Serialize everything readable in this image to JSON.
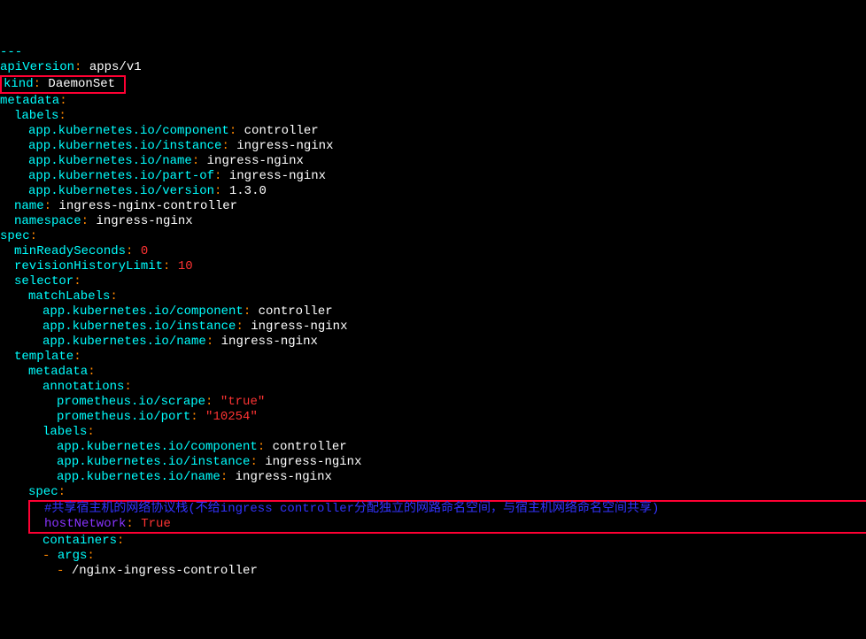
{
  "separator": "---",
  "apiVersion": {
    "key": "apiVersion",
    "value": "apps/v1"
  },
  "kind": {
    "key": "kind",
    "value": "DaemonSet"
  },
  "metadata": {
    "key": "metadata",
    "labelsKey": "labels",
    "labels": {
      "componentKey": "app.kubernetes.io/component",
      "componentVal": "controller",
      "instanceKey": "app.kubernetes.io/instance",
      "instanceVal": "ingress-nginx",
      "nameKey": "app.kubernetes.io/name",
      "nameVal": "ingress-nginx",
      "partofKey": "app.kubernetes.io/part-of",
      "partofVal": "ingress-nginx",
      "versionKey": "app.kubernetes.io/version",
      "versionVal": "1.3.0"
    },
    "nameKey": "name",
    "nameVal": "ingress-nginx-controller",
    "nsKey": "namespace",
    "nsVal": "ingress-nginx"
  },
  "spec": {
    "key": "spec",
    "minReadyKey": "minReadySeconds",
    "minReadyVal": "0",
    "revHistKey": "revisionHistoryLimit",
    "revHistVal": "10",
    "selectorKey": "selector",
    "matchLabelsKey": "matchLabels",
    "selectorLabels": {
      "componentKey": "app.kubernetes.io/component",
      "componentVal": "controller",
      "instanceKey": "app.kubernetes.io/instance",
      "instanceVal": "ingress-nginx",
      "nameKey": "app.kubernetes.io/name",
      "nameVal": "ingress-nginx"
    },
    "templateKey": "template",
    "tmplMetaKey": "metadata",
    "annotationsKey": "annotations",
    "annotations": {
      "scrapeKey": "prometheus.io/scrape",
      "scrapeVal": "\"true\"",
      "portKey": "prometheus.io/port",
      "portVal": "\"10254\""
    },
    "tmplLabelsKey": "labels",
    "tmplLabels": {
      "componentKey": "app.kubernetes.io/component",
      "componentVal": "controller",
      "instanceKey": "app.kubernetes.io/instance",
      "instanceVal": "ingress-nginx",
      "nameKey": "app.kubernetes.io/name",
      "nameVal": "ingress-nginx"
    },
    "specKey": "spec",
    "comment": "#共享宿主机的网络协议栈(不给ingress controller分配独立的网路命名空间，与宿主机网络命名空间共享)",
    "hostNetKey": "hostNetwork",
    "hostNetVal": "True",
    "containersKey": "containers",
    "argsKey": "args",
    "dash": "-",
    "arg0": "/nginx-ingress-controller"
  },
  "colon": ":"
}
